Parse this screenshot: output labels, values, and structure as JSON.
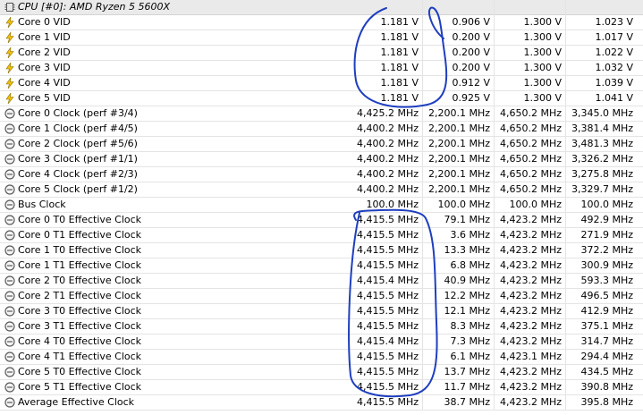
{
  "header": {
    "title": "CPU [#0]: AMD Ryzen 5 5600X",
    "icon": "chip-icon"
  },
  "rows": [
    {
      "name": "Core 0 VID",
      "icon": "voltage-icon",
      "values": [
        "1.181 V",
        "0.906 V",
        "1.300 V",
        "1.023 V"
      ]
    },
    {
      "name": "Core 1 VID",
      "icon": "voltage-icon",
      "values": [
        "1.181 V",
        "0.200 V",
        "1.300 V",
        "1.017 V"
      ]
    },
    {
      "name": "Core 2 VID",
      "icon": "voltage-icon",
      "values": [
        "1.181 V",
        "0.200 V",
        "1.300 V",
        "1.022 V"
      ]
    },
    {
      "name": "Core 3 VID",
      "icon": "voltage-icon",
      "values": [
        "1.181 V",
        "0.200 V",
        "1.300 V",
        "1.032 V"
      ]
    },
    {
      "name": "Core 4 VID",
      "icon": "voltage-icon",
      "values": [
        "1.181 V",
        "0.912 V",
        "1.300 V",
        "1.039 V"
      ]
    },
    {
      "name": "Core 5 VID",
      "icon": "voltage-icon",
      "values": [
        "1.181 V",
        "0.925 V",
        "1.300 V",
        "1.041 V"
      ]
    },
    {
      "name": "Core 0 Clock (perf #3/4)",
      "icon": "clock-icon",
      "values": [
        "4,425.2 MHz",
        "2,200.1 MHz",
        "4,650.2 MHz",
        "3,345.0 MHz"
      ]
    },
    {
      "name": "Core 1 Clock (perf #4/5)",
      "icon": "clock-icon",
      "values": [
        "4,400.2 MHz",
        "2,200.1 MHz",
        "4,650.2 MHz",
        "3,381.4 MHz"
      ]
    },
    {
      "name": "Core 2 Clock (perf #5/6)",
      "icon": "clock-icon",
      "values": [
        "4,400.2 MHz",
        "2,200.1 MHz",
        "4,650.2 MHz",
        "3,481.3 MHz"
      ]
    },
    {
      "name": "Core 3 Clock (perf #1/1)",
      "icon": "clock-icon",
      "values": [
        "4,400.2 MHz",
        "2,200.1 MHz",
        "4,650.2 MHz",
        "3,326.2 MHz"
      ]
    },
    {
      "name": "Core 4 Clock (perf #2/3)",
      "icon": "clock-icon",
      "values": [
        "4,400.2 MHz",
        "2,200.1 MHz",
        "4,650.2 MHz",
        "3,275.8 MHz"
      ]
    },
    {
      "name": "Core 5 Clock (perf #1/2)",
      "icon": "clock-icon",
      "values": [
        "4,400.2 MHz",
        "2,200.1 MHz",
        "4,650.2 MHz",
        "3,329.7 MHz"
      ]
    },
    {
      "name": "Bus Clock",
      "icon": "clock-icon",
      "values": [
        "100.0 MHz",
        "100.0 MHz",
        "100.0 MHz",
        "100.0 MHz"
      ]
    },
    {
      "name": "Core 0 T0 Effective Clock",
      "icon": "clock-icon",
      "values": [
        "4,415.5 MHz",
        "79.1 MHz",
        "4,423.2 MHz",
        "492.9 MHz"
      ]
    },
    {
      "name": "Core 0 T1 Effective Clock",
      "icon": "clock-icon",
      "values": [
        "4,415.5 MHz",
        "3.6 MHz",
        "4,423.2 MHz",
        "271.9 MHz"
      ]
    },
    {
      "name": "Core 1 T0 Effective Clock",
      "icon": "clock-icon",
      "values": [
        "4,415.5 MHz",
        "13.3 MHz",
        "4,423.2 MHz",
        "372.2 MHz"
      ]
    },
    {
      "name": "Core 1 T1 Effective Clock",
      "icon": "clock-icon",
      "values": [
        "4,415.5 MHz",
        "6.8 MHz",
        "4,423.2 MHz",
        "300.9 MHz"
      ]
    },
    {
      "name": "Core 2 T0 Effective Clock",
      "icon": "clock-icon",
      "values": [
        "4,415.4 MHz",
        "40.9 MHz",
        "4,423.2 MHz",
        "593.3 MHz"
      ]
    },
    {
      "name": "Core 2 T1 Effective Clock",
      "icon": "clock-icon",
      "values": [
        "4,415.5 MHz",
        "12.2 MHz",
        "4,423.2 MHz",
        "496.5 MHz"
      ]
    },
    {
      "name": "Core 3 T0 Effective Clock",
      "icon": "clock-icon",
      "values": [
        "4,415.5 MHz",
        "12.1 MHz",
        "4,423.2 MHz",
        "412.9 MHz"
      ]
    },
    {
      "name": "Core 3 T1 Effective Clock",
      "icon": "clock-icon",
      "values": [
        "4,415.5 MHz",
        "8.3 MHz",
        "4,423.2 MHz",
        "375.1 MHz"
      ]
    },
    {
      "name": "Core 4 T0 Effective Clock",
      "icon": "clock-icon",
      "values": [
        "4,415.4 MHz",
        "7.3 MHz",
        "4,423.2 MHz",
        "314.7 MHz"
      ]
    },
    {
      "name": "Core 4 T1 Effective Clock",
      "icon": "clock-icon",
      "values": [
        "4,415.5 MHz",
        "6.1 MHz",
        "4,423.1 MHz",
        "294.4 MHz"
      ]
    },
    {
      "name": "Core 5 T0 Effective Clock",
      "icon": "clock-icon",
      "values": [
        "4,415.5 MHz",
        "13.7 MHz",
        "4,423.2 MHz",
        "434.5 MHz"
      ]
    },
    {
      "name": "Core 5 T1 Effective Clock",
      "icon": "clock-icon",
      "values": [
        "4,415.5 MHz",
        "11.7 MHz",
        "4,423.2 MHz",
        "390.8 MHz"
      ]
    },
    {
      "name": "Average Effective Clock",
      "icon": "clock-icon",
      "values": [
        "4,415.5 MHz",
        "38.7 MHz",
        "4,423.2 MHz",
        "395.8 MHz"
      ]
    }
  ],
  "annotation_color": "#1f3fbf",
  "colors": {
    "voltage": "#f2c200",
    "clock_ring": "#5a5a5a",
    "header_bg": "#eaeaea"
  }
}
